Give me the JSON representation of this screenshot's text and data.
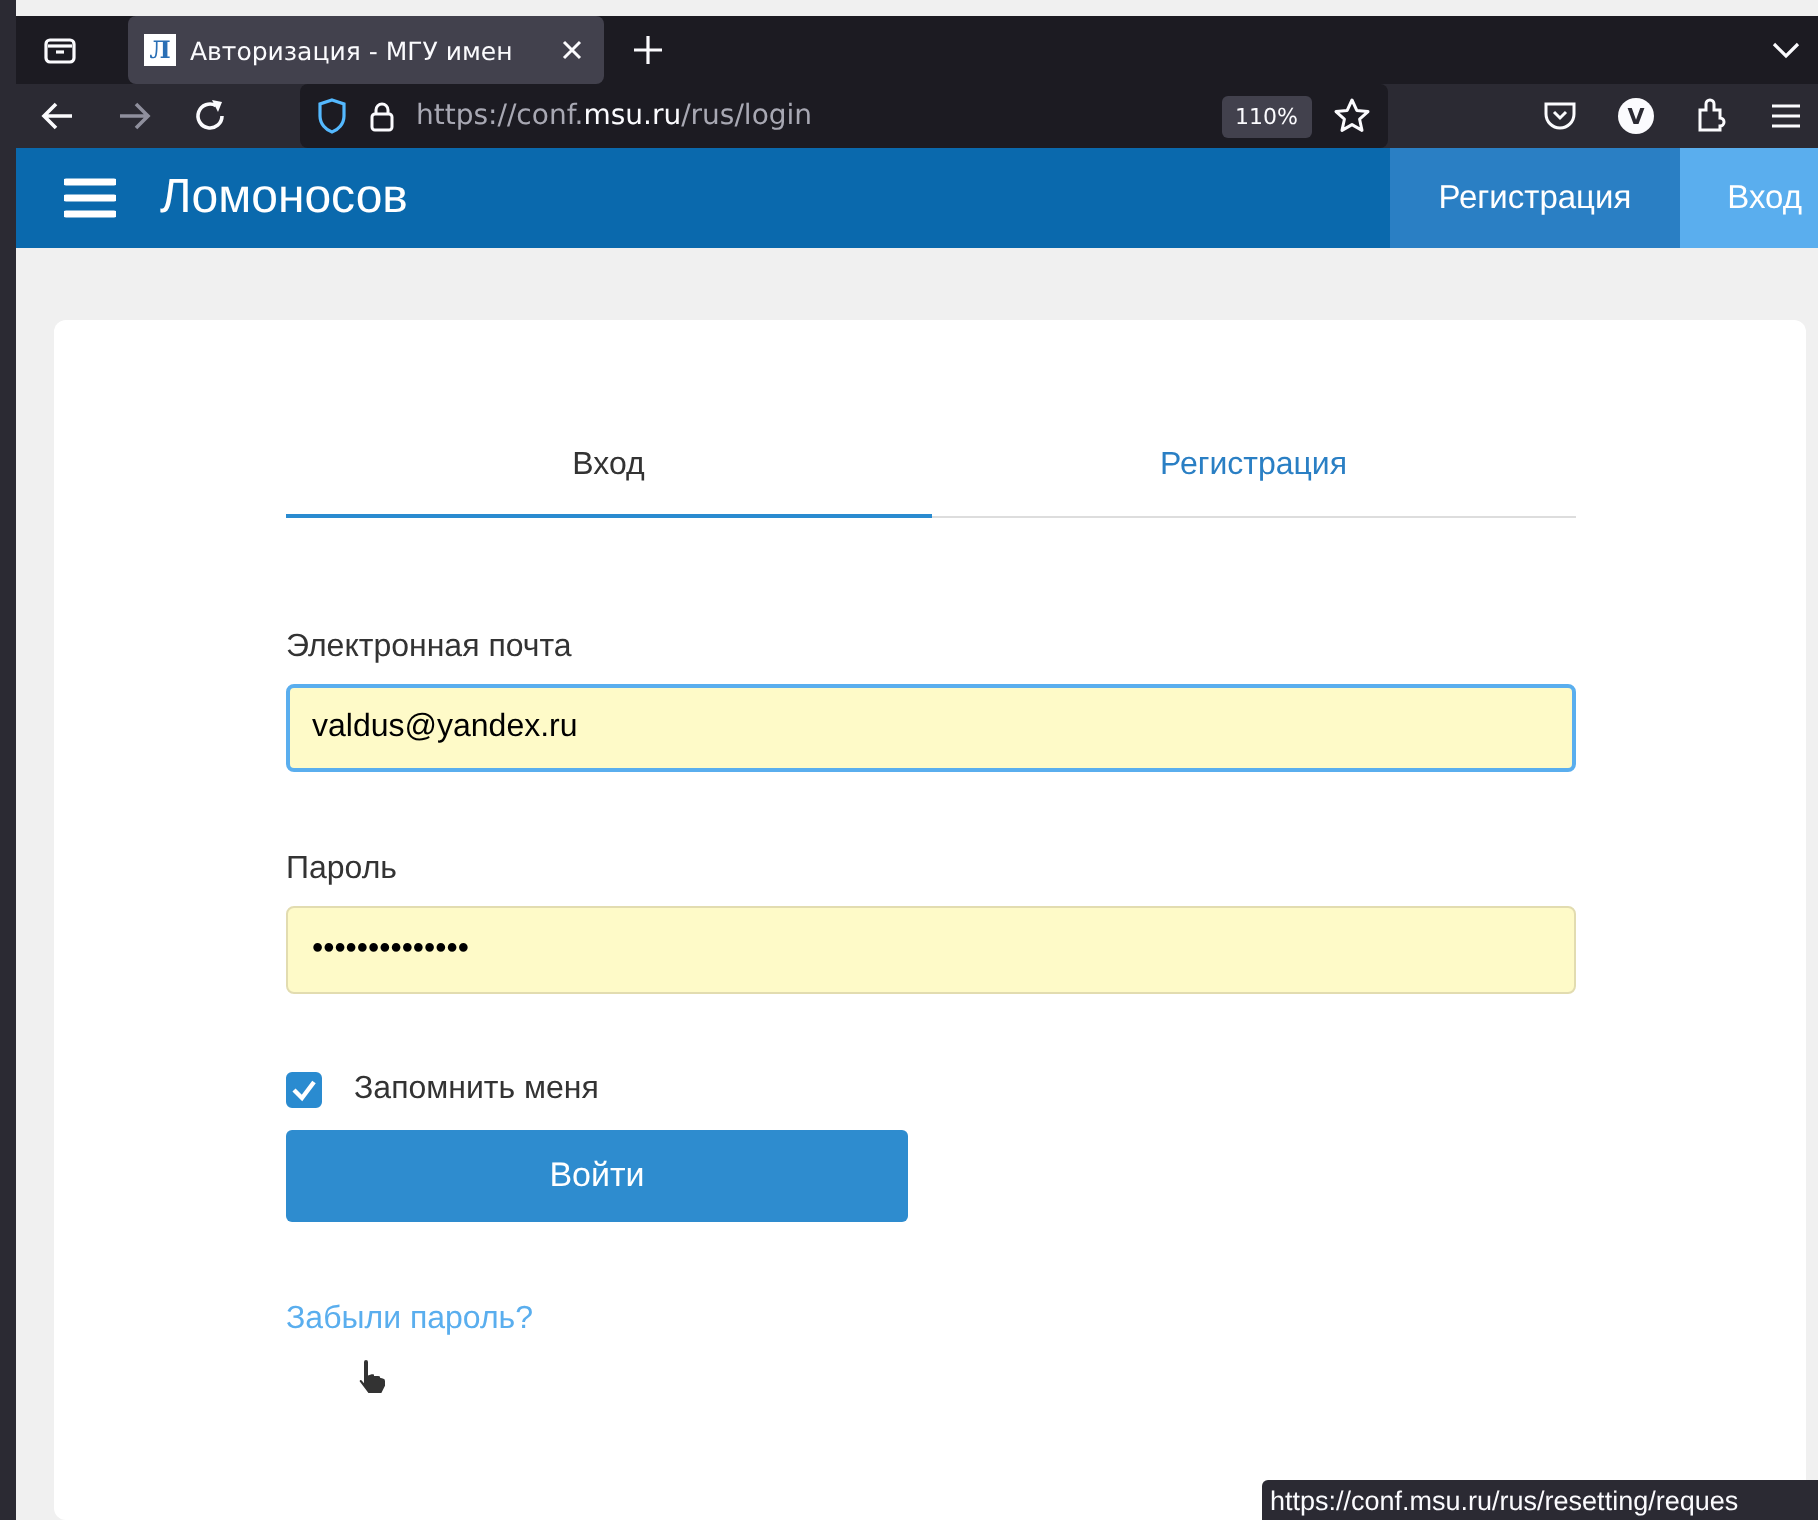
{
  "browser": {
    "tab": {
      "favicon": "Л",
      "title": "Авторизация - МГУ имен",
      "selected": true
    },
    "url": {
      "prefix": "https://conf.",
      "domain": "msu.ru",
      "path": "/rus/login"
    },
    "zoom": "110%",
    "profile": "V"
  },
  "header": {
    "brand": "Ломоносов",
    "nav": [
      {
        "label": "Регистрация",
        "selected": false
      },
      {
        "label": "Вход",
        "selected": true
      }
    ]
  },
  "form": {
    "tabs": [
      {
        "label": "Вход",
        "selected": true
      },
      {
        "label": "Регистрация",
        "selected": false
      }
    ],
    "fields": [
      {
        "label": "Электронная почта",
        "value": "valdus@yandex.ru",
        "focused": true
      },
      {
        "label": "Пароль",
        "value": "••••••••••••••",
        "focused": false
      }
    ],
    "remember": {
      "label": "Запомнить меня",
      "checked": true
    },
    "submit": "Войти",
    "forgot": "Забыли пароль?"
  },
  "status_url": "https://conf.msu.ru/rus/resetting/reques"
}
